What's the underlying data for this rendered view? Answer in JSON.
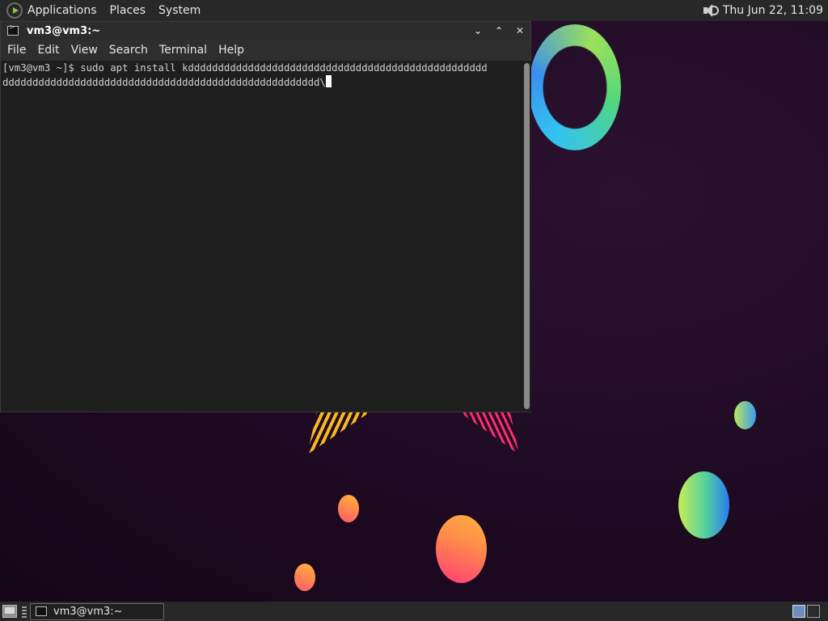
{
  "top_panel": {
    "menus": [
      "Applications",
      "Places",
      "System"
    ],
    "clock": "Thu Jun 22, 11:09"
  },
  "terminal": {
    "title": "vm3@vm3:~",
    "window_buttons": [
      "⌄",
      "⌃",
      "✕"
    ],
    "menu": [
      "File",
      "Edit",
      "View",
      "Search",
      "Terminal",
      "Help"
    ],
    "lines": [
      "[vm3@vm3 ~]$ sudo apt install kdddddddddddddddddddddddddddddddddddddddddddddddddd",
      "ddddddddddddddddddddddddddddddddddddddddddddddddddddd\\"
    ]
  },
  "bottom_panel": {
    "task_label": "vm3@vm3:~",
    "workspaces": 2,
    "active_workspace": 1
  },
  "colors": {
    "panel_bg": "#282828",
    "terminal_bg": "#1e1e1e",
    "terminal_fg": "#d0d0d0",
    "wallpaper_bg": "#1e0a22"
  },
  "icons": [
    "menu-logo-icon",
    "volume-icon",
    "terminal-icon",
    "show-desktop-icon",
    "cursor-block"
  ]
}
